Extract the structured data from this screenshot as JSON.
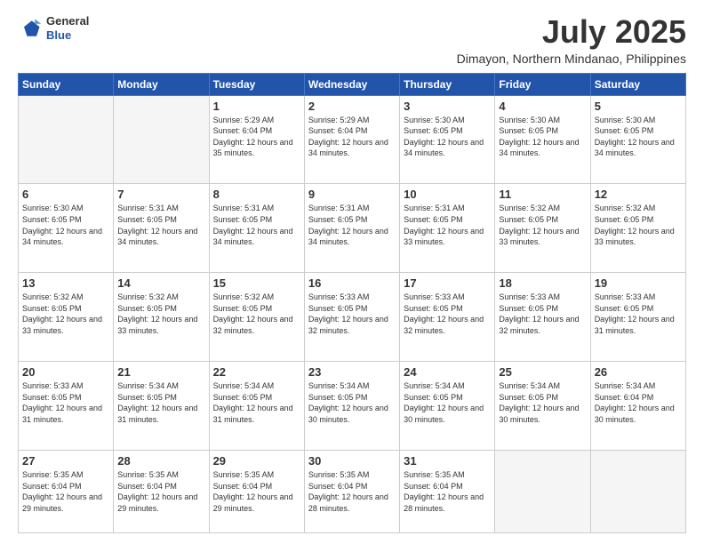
{
  "header": {
    "logo": {
      "general": "General",
      "blue": "Blue"
    },
    "title": "July 2025",
    "location": "Dimayon, Northern Mindanao, Philippines"
  },
  "weekdays": [
    "Sunday",
    "Monday",
    "Tuesday",
    "Wednesday",
    "Thursday",
    "Friday",
    "Saturday"
  ],
  "weeks": [
    [
      {
        "day": null
      },
      {
        "day": null
      },
      {
        "day": 1,
        "sunrise": "5:29 AM",
        "sunset": "6:04 PM",
        "daylight": "12 hours and 35 minutes."
      },
      {
        "day": 2,
        "sunrise": "5:29 AM",
        "sunset": "6:04 PM",
        "daylight": "12 hours and 34 minutes."
      },
      {
        "day": 3,
        "sunrise": "5:30 AM",
        "sunset": "6:05 PM",
        "daylight": "12 hours and 34 minutes."
      },
      {
        "day": 4,
        "sunrise": "5:30 AM",
        "sunset": "6:05 PM",
        "daylight": "12 hours and 34 minutes."
      },
      {
        "day": 5,
        "sunrise": "5:30 AM",
        "sunset": "6:05 PM",
        "daylight": "12 hours and 34 minutes."
      }
    ],
    [
      {
        "day": 6,
        "sunrise": "5:30 AM",
        "sunset": "6:05 PM",
        "daylight": "12 hours and 34 minutes."
      },
      {
        "day": 7,
        "sunrise": "5:31 AM",
        "sunset": "6:05 PM",
        "daylight": "12 hours and 34 minutes."
      },
      {
        "day": 8,
        "sunrise": "5:31 AM",
        "sunset": "6:05 PM",
        "daylight": "12 hours and 34 minutes."
      },
      {
        "day": 9,
        "sunrise": "5:31 AM",
        "sunset": "6:05 PM",
        "daylight": "12 hours and 34 minutes."
      },
      {
        "day": 10,
        "sunrise": "5:31 AM",
        "sunset": "6:05 PM",
        "daylight": "12 hours and 33 minutes."
      },
      {
        "day": 11,
        "sunrise": "5:32 AM",
        "sunset": "6:05 PM",
        "daylight": "12 hours and 33 minutes."
      },
      {
        "day": 12,
        "sunrise": "5:32 AM",
        "sunset": "6:05 PM",
        "daylight": "12 hours and 33 minutes."
      }
    ],
    [
      {
        "day": 13,
        "sunrise": "5:32 AM",
        "sunset": "6:05 PM",
        "daylight": "12 hours and 33 minutes."
      },
      {
        "day": 14,
        "sunrise": "5:32 AM",
        "sunset": "6:05 PM",
        "daylight": "12 hours and 33 minutes."
      },
      {
        "day": 15,
        "sunrise": "5:32 AM",
        "sunset": "6:05 PM",
        "daylight": "12 hours and 32 minutes."
      },
      {
        "day": 16,
        "sunrise": "5:33 AM",
        "sunset": "6:05 PM",
        "daylight": "12 hours and 32 minutes."
      },
      {
        "day": 17,
        "sunrise": "5:33 AM",
        "sunset": "6:05 PM",
        "daylight": "12 hours and 32 minutes."
      },
      {
        "day": 18,
        "sunrise": "5:33 AM",
        "sunset": "6:05 PM",
        "daylight": "12 hours and 32 minutes."
      },
      {
        "day": 19,
        "sunrise": "5:33 AM",
        "sunset": "6:05 PM",
        "daylight": "12 hours and 31 minutes."
      }
    ],
    [
      {
        "day": 20,
        "sunrise": "5:33 AM",
        "sunset": "6:05 PM",
        "daylight": "12 hours and 31 minutes."
      },
      {
        "day": 21,
        "sunrise": "5:34 AM",
        "sunset": "6:05 PM",
        "daylight": "12 hours and 31 minutes."
      },
      {
        "day": 22,
        "sunrise": "5:34 AM",
        "sunset": "6:05 PM",
        "daylight": "12 hours and 31 minutes."
      },
      {
        "day": 23,
        "sunrise": "5:34 AM",
        "sunset": "6:05 PM",
        "daylight": "12 hours and 30 minutes."
      },
      {
        "day": 24,
        "sunrise": "5:34 AM",
        "sunset": "6:05 PM",
        "daylight": "12 hours and 30 minutes."
      },
      {
        "day": 25,
        "sunrise": "5:34 AM",
        "sunset": "6:05 PM",
        "daylight": "12 hours and 30 minutes."
      },
      {
        "day": 26,
        "sunrise": "5:34 AM",
        "sunset": "6:04 PM",
        "daylight": "12 hours and 30 minutes."
      }
    ],
    [
      {
        "day": 27,
        "sunrise": "5:35 AM",
        "sunset": "6:04 PM",
        "daylight": "12 hours and 29 minutes."
      },
      {
        "day": 28,
        "sunrise": "5:35 AM",
        "sunset": "6:04 PM",
        "daylight": "12 hours and 29 minutes."
      },
      {
        "day": 29,
        "sunrise": "5:35 AM",
        "sunset": "6:04 PM",
        "daylight": "12 hours and 29 minutes."
      },
      {
        "day": 30,
        "sunrise": "5:35 AM",
        "sunset": "6:04 PM",
        "daylight": "12 hours and 28 minutes."
      },
      {
        "day": 31,
        "sunrise": "5:35 AM",
        "sunset": "6:04 PM",
        "daylight": "12 hours and 28 minutes."
      },
      {
        "day": null
      },
      {
        "day": null
      }
    ]
  ]
}
